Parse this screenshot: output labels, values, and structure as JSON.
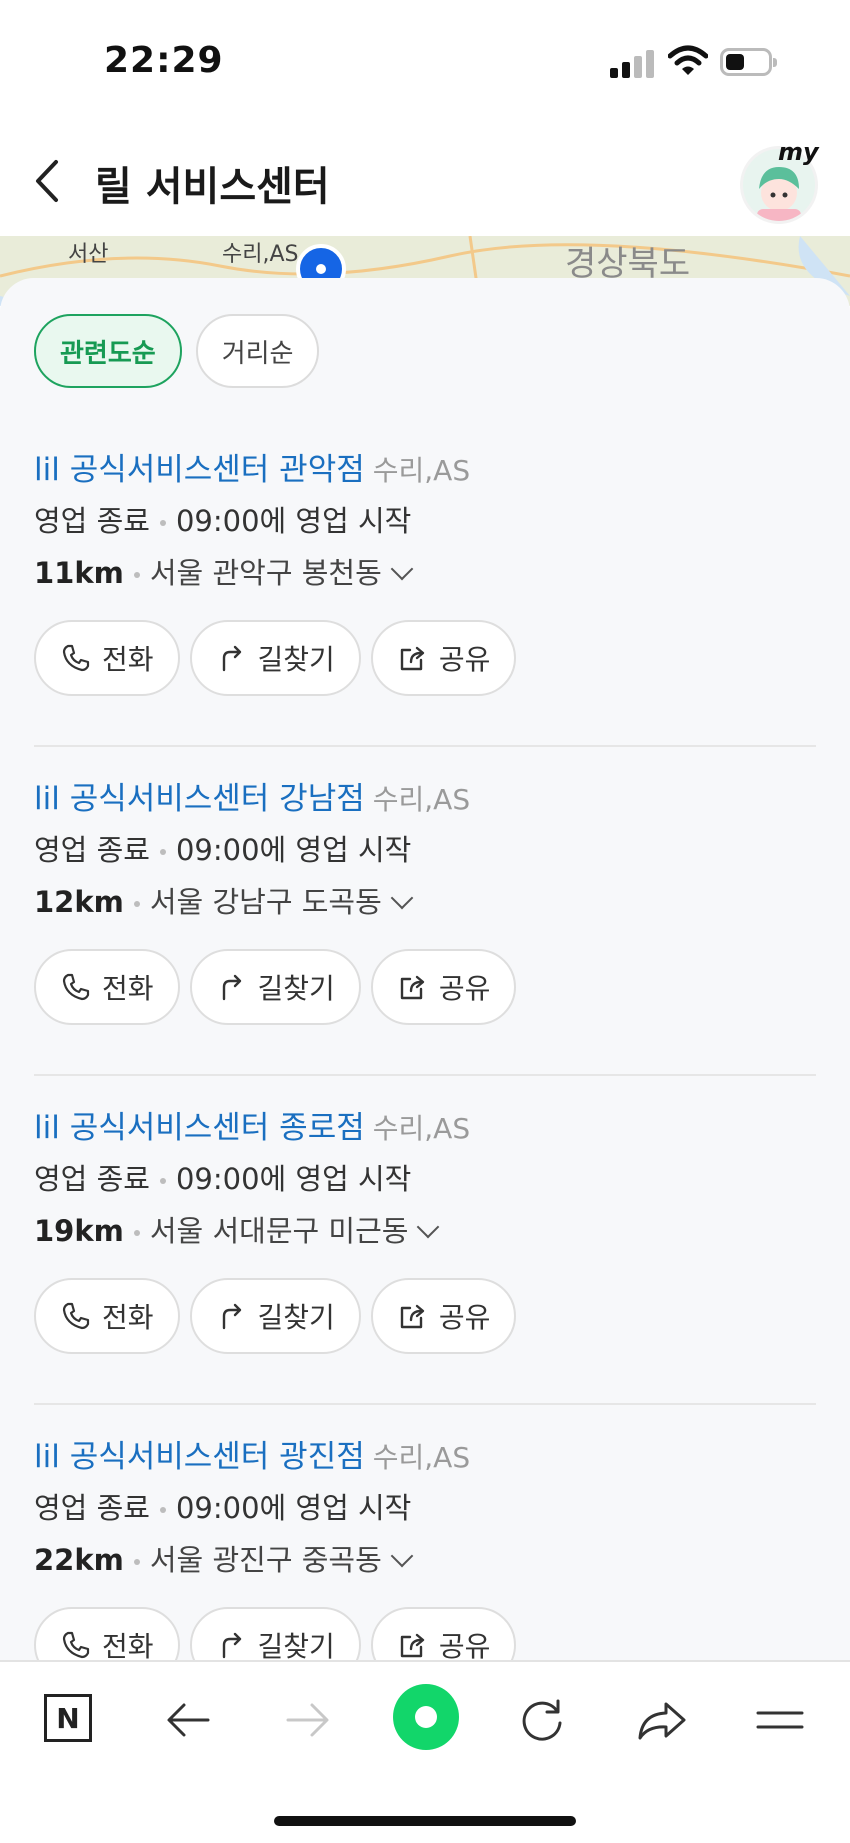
{
  "status": {
    "time": "22:29"
  },
  "header": {
    "title": "릴 서비스센터",
    "avatar_badge": "my"
  },
  "map": {
    "labels": [
      "서산",
      "수리,AS",
      "경상북도"
    ]
  },
  "sort_chips": [
    {
      "label": "관련도순",
      "active": true
    },
    {
      "label": "거리순",
      "active": false
    }
  ],
  "results": [
    {
      "name": "lil 공식서비스센터 관악점",
      "category": "수리,AS",
      "status": "영업 종료",
      "opens": "09:00에 영업 시작",
      "distance": "11km",
      "address": "서울 관악구 봉천동"
    },
    {
      "name": "lil 공식서비스센터 강남점",
      "category": "수리,AS",
      "status": "영업 종료",
      "opens": "09:00에 영업 시작",
      "distance": "12km",
      "address": "서울 강남구 도곡동"
    },
    {
      "name": "lil 공식서비스센터 종로점",
      "category": "수리,AS",
      "status": "영업 종료",
      "opens": "09:00에 영업 시작",
      "distance": "19km",
      "address": "서울 서대문구 미근동"
    },
    {
      "name": "lil 공식서비스센터 광진점",
      "category": "수리,AS",
      "status": "영업 종료",
      "opens": "09:00에 영업 시작",
      "distance": "22km",
      "address": "서울 광진구 중곡동"
    }
  ],
  "actions": {
    "call": "전화",
    "directions": "길찾기",
    "share": "공유"
  },
  "bottom_bar": {
    "n_label": "N",
    "accent": "#12d66a"
  },
  "colors": {
    "link": "#1a6fc0",
    "chip_active": "#179a53"
  }
}
